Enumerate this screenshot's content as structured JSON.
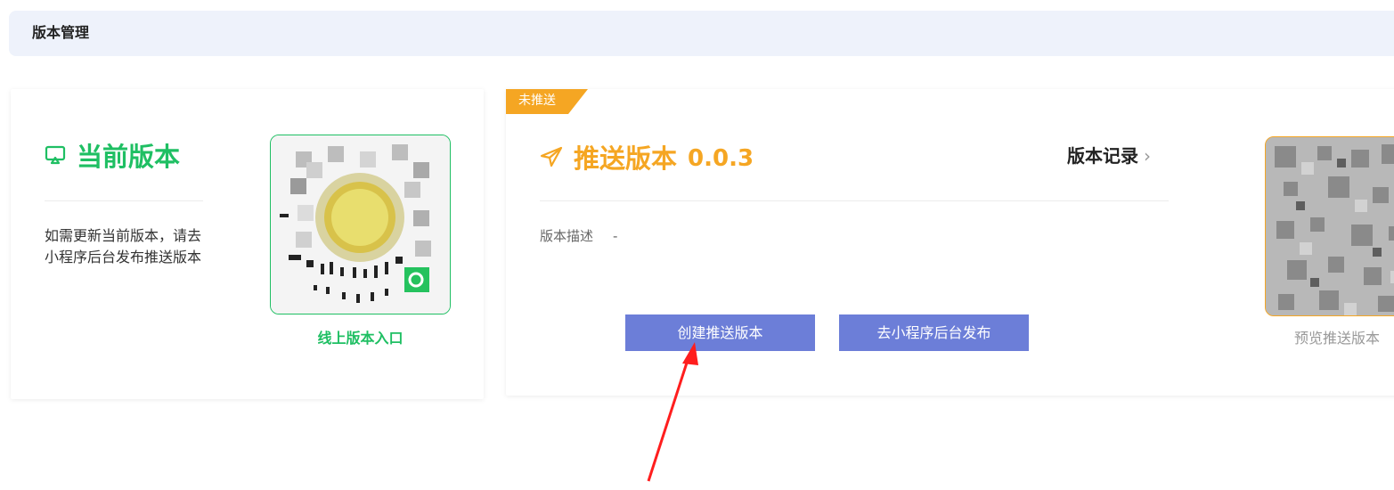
{
  "header": {
    "title": "版本管理"
  },
  "current_version": {
    "title": "当前版本",
    "description": "如需更新当前版本，请去小程序后台发布推送版本",
    "qr_link": "线上版本入口",
    "icon": "monitor-icon"
  },
  "push_version": {
    "status_badge": "未推送",
    "title": "推送版本",
    "version": "0.0.3",
    "history_link": "版本记录",
    "description_label": "版本描述",
    "description_value": "-",
    "create_button": "创建推送版本",
    "publish_button": "去小程序后台发布",
    "preview_label": "预览推送版本",
    "icon": "send-icon"
  },
  "colors": {
    "green": "#1fbf63",
    "orange": "#f5a623",
    "button": "#6c7ed8",
    "annotation_arrow": "#ff1e1e"
  }
}
